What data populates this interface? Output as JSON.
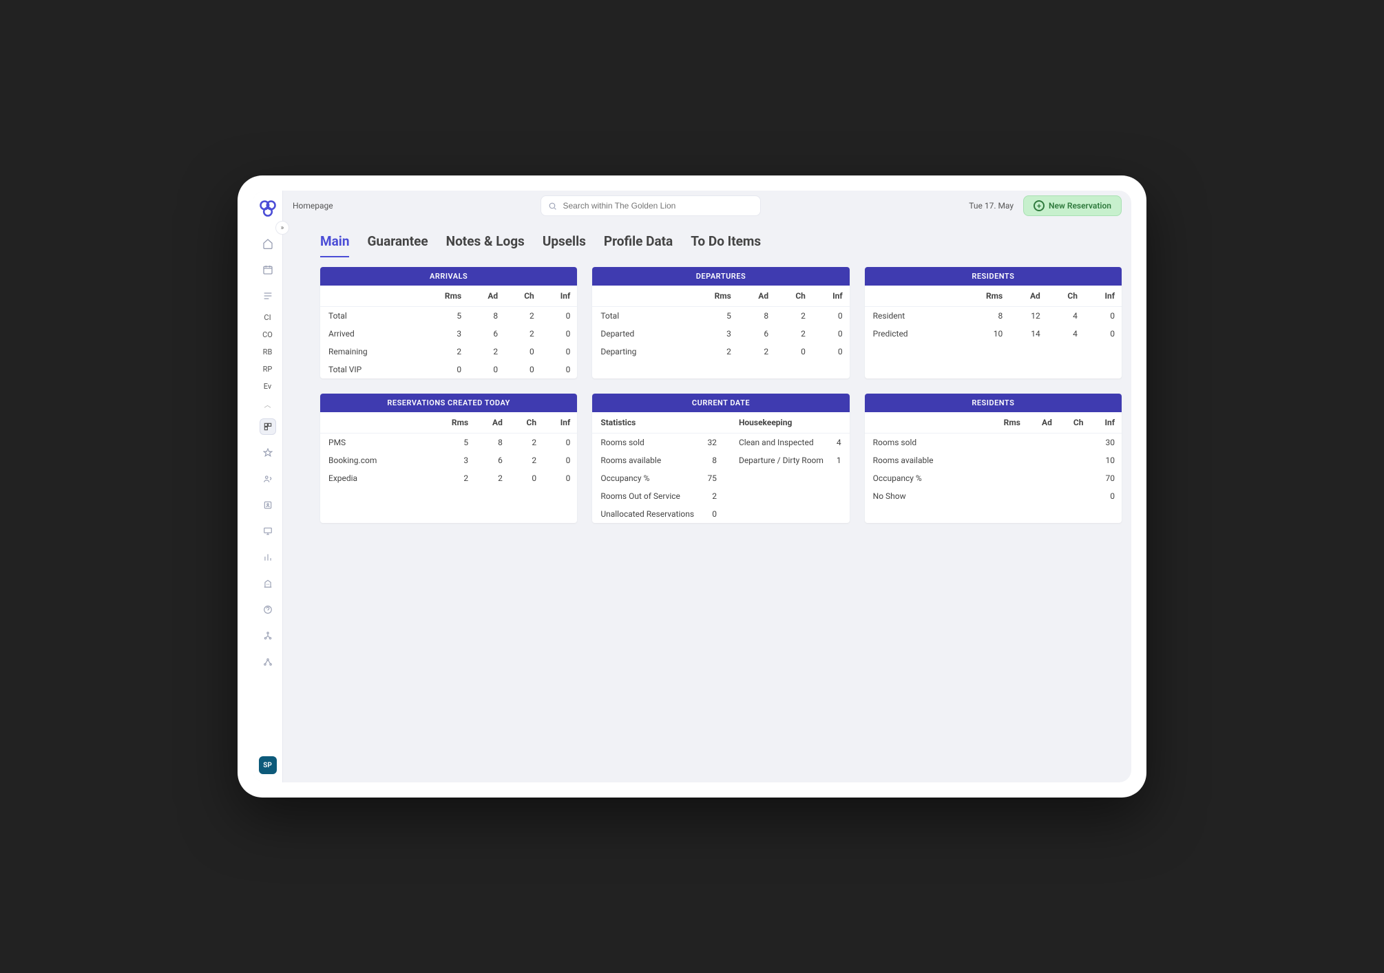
{
  "page_title": "Homepage",
  "search_placeholder": "Search within The Golden Lion",
  "date": "Tue 17. May",
  "new_reservation": "New Reservation",
  "avatar": "SP",
  "side_text": [
    "CI",
    "CO",
    "RB",
    "RP",
    "Ev"
  ],
  "tabs": [
    "Main",
    "Guarantee",
    "Notes & Logs",
    "Upsells",
    "Profile Data",
    "To Do Items"
  ],
  "active_tab": 0,
  "col_headers": [
    "Rms",
    "Ad",
    "Ch",
    "Inf"
  ],
  "cards": {
    "arrivals": {
      "title": "ARRIVALS",
      "rows": [
        {
          "label": "Total",
          "v": [
            "5",
            "8",
            "2",
            "0"
          ]
        },
        {
          "label": "Arrived",
          "v": [
            "3",
            "6",
            "2",
            "0"
          ]
        },
        {
          "label": "Remaining",
          "v": [
            "2",
            "2",
            "0",
            "0"
          ]
        },
        {
          "label": "Total VIP",
          "v": [
            "0",
            "0",
            "0",
            "0"
          ]
        }
      ]
    },
    "departures": {
      "title": "DEPARTURES",
      "rows": [
        {
          "label": "Total",
          "v": [
            "5",
            "8",
            "2",
            "0"
          ]
        },
        {
          "label": "Departed",
          "v": [
            "3",
            "6",
            "2",
            "0"
          ]
        },
        {
          "label": "Departing",
          "v": [
            "2",
            "2",
            "0",
            "0"
          ]
        }
      ]
    },
    "residents": {
      "title": "RESIDENTS",
      "rows": [
        {
          "label": "Resident",
          "v": [
            "8",
            "12",
            "4",
            "0"
          ]
        },
        {
          "label": "Predicted",
          "v": [
            "10",
            "14",
            "4",
            "0"
          ]
        }
      ]
    },
    "reservations": {
      "title": "RESERVATIONS CREATED TODAY",
      "rows": [
        {
          "label": "PMS",
          "v": [
            "5",
            "8",
            "2",
            "0"
          ]
        },
        {
          "label": "Booking.com",
          "v": [
            "3",
            "6",
            "2",
            "0"
          ]
        },
        {
          "label": "Expedia",
          "v": [
            "2",
            "2",
            "0",
            "0"
          ]
        }
      ]
    },
    "current": {
      "title": "CURRENT DATE",
      "stat_head": "Statistics",
      "hk_head": "Housekeeping",
      "stats": [
        {
          "label": "Rooms sold",
          "val": "32"
        },
        {
          "label": "Rooms available",
          "val": "8"
        },
        {
          "label": "Occupancy %",
          "val": "75"
        },
        {
          "label": "Rooms Out of Service",
          "val": "2"
        },
        {
          "label": "Unallocated Reservations",
          "val": "0"
        }
      ],
      "hk": [
        {
          "label": "Clean and Inspected",
          "val": "4"
        },
        {
          "label": "Departure / Dirty Room",
          "val": "1"
        }
      ]
    },
    "residents2": {
      "title": "RESIDENTS",
      "rows": [
        {
          "label": "Rooms sold",
          "val": "30"
        },
        {
          "label": "Rooms available",
          "val": "10"
        },
        {
          "label": "Occupancy %",
          "val": "70"
        },
        {
          "label": "No Show",
          "val": "0"
        }
      ]
    }
  }
}
